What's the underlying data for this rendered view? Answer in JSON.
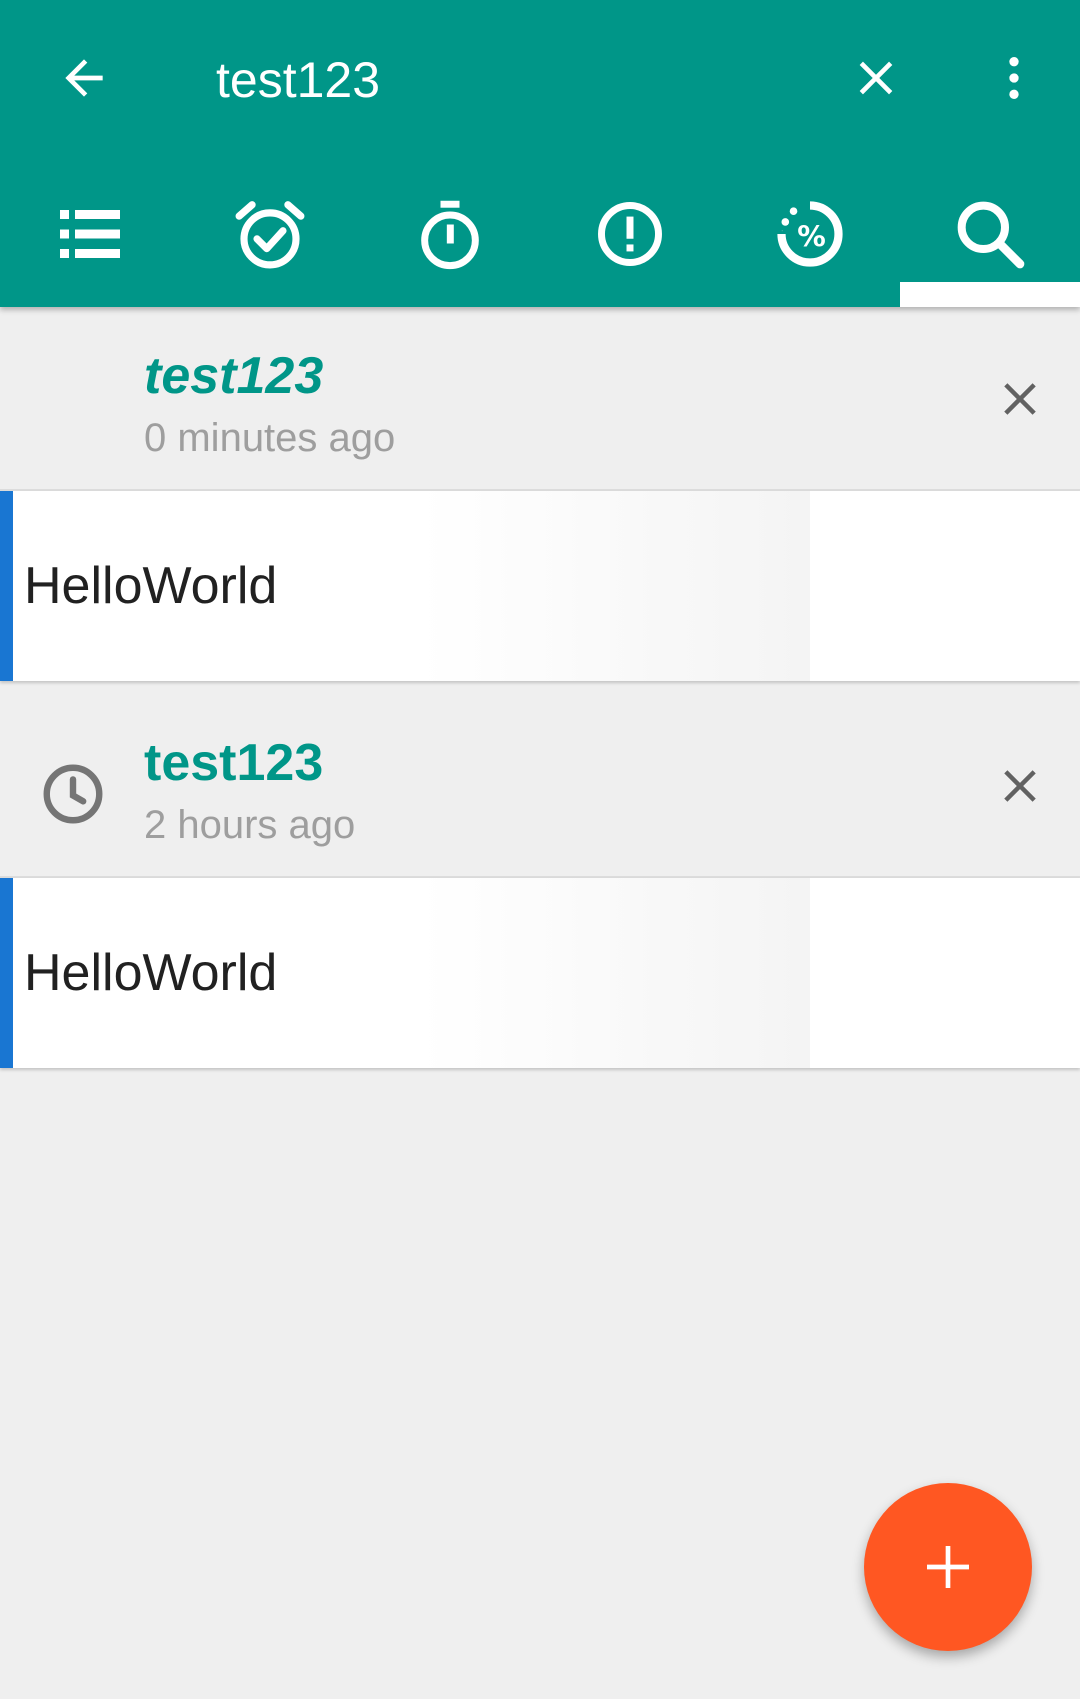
{
  "toolbar": {
    "query": "test123",
    "back_icon": "arrow-back-icon",
    "clear_icon": "close-icon",
    "more_icon": "more-vert-icon"
  },
  "tabs": [
    {
      "name": "list",
      "icon": "list-icon"
    },
    {
      "name": "alarm",
      "icon": "alarm-check-icon"
    },
    {
      "name": "timer",
      "icon": "stopwatch-icon"
    },
    {
      "name": "priority",
      "icon": "exclamation-circle-icon"
    },
    {
      "name": "progress",
      "icon": "percent-circle-icon"
    },
    {
      "name": "search",
      "icon": "search-icon",
      "selected": true
    }
  ],
  "history": [
    {
      "query": "test123",
      "time": "0 minutes ago"
    },
    {
      "query": "test123",
      "time": "2 hours ago",
      "icon": "clock-icon"
    }
  ],
  "results": [
    {
      "title": "HelloWorld"
    },
    {
      "title": "HelloWorld"
    }
  ],
  "fab": {
    "icon": "plus-icon"
  },
  "colors": {
    "primary": "#009688",
    "accent": "#ff5722",
    "stripe": "#1976d2",
    "background": "#efefef"
  }
}
